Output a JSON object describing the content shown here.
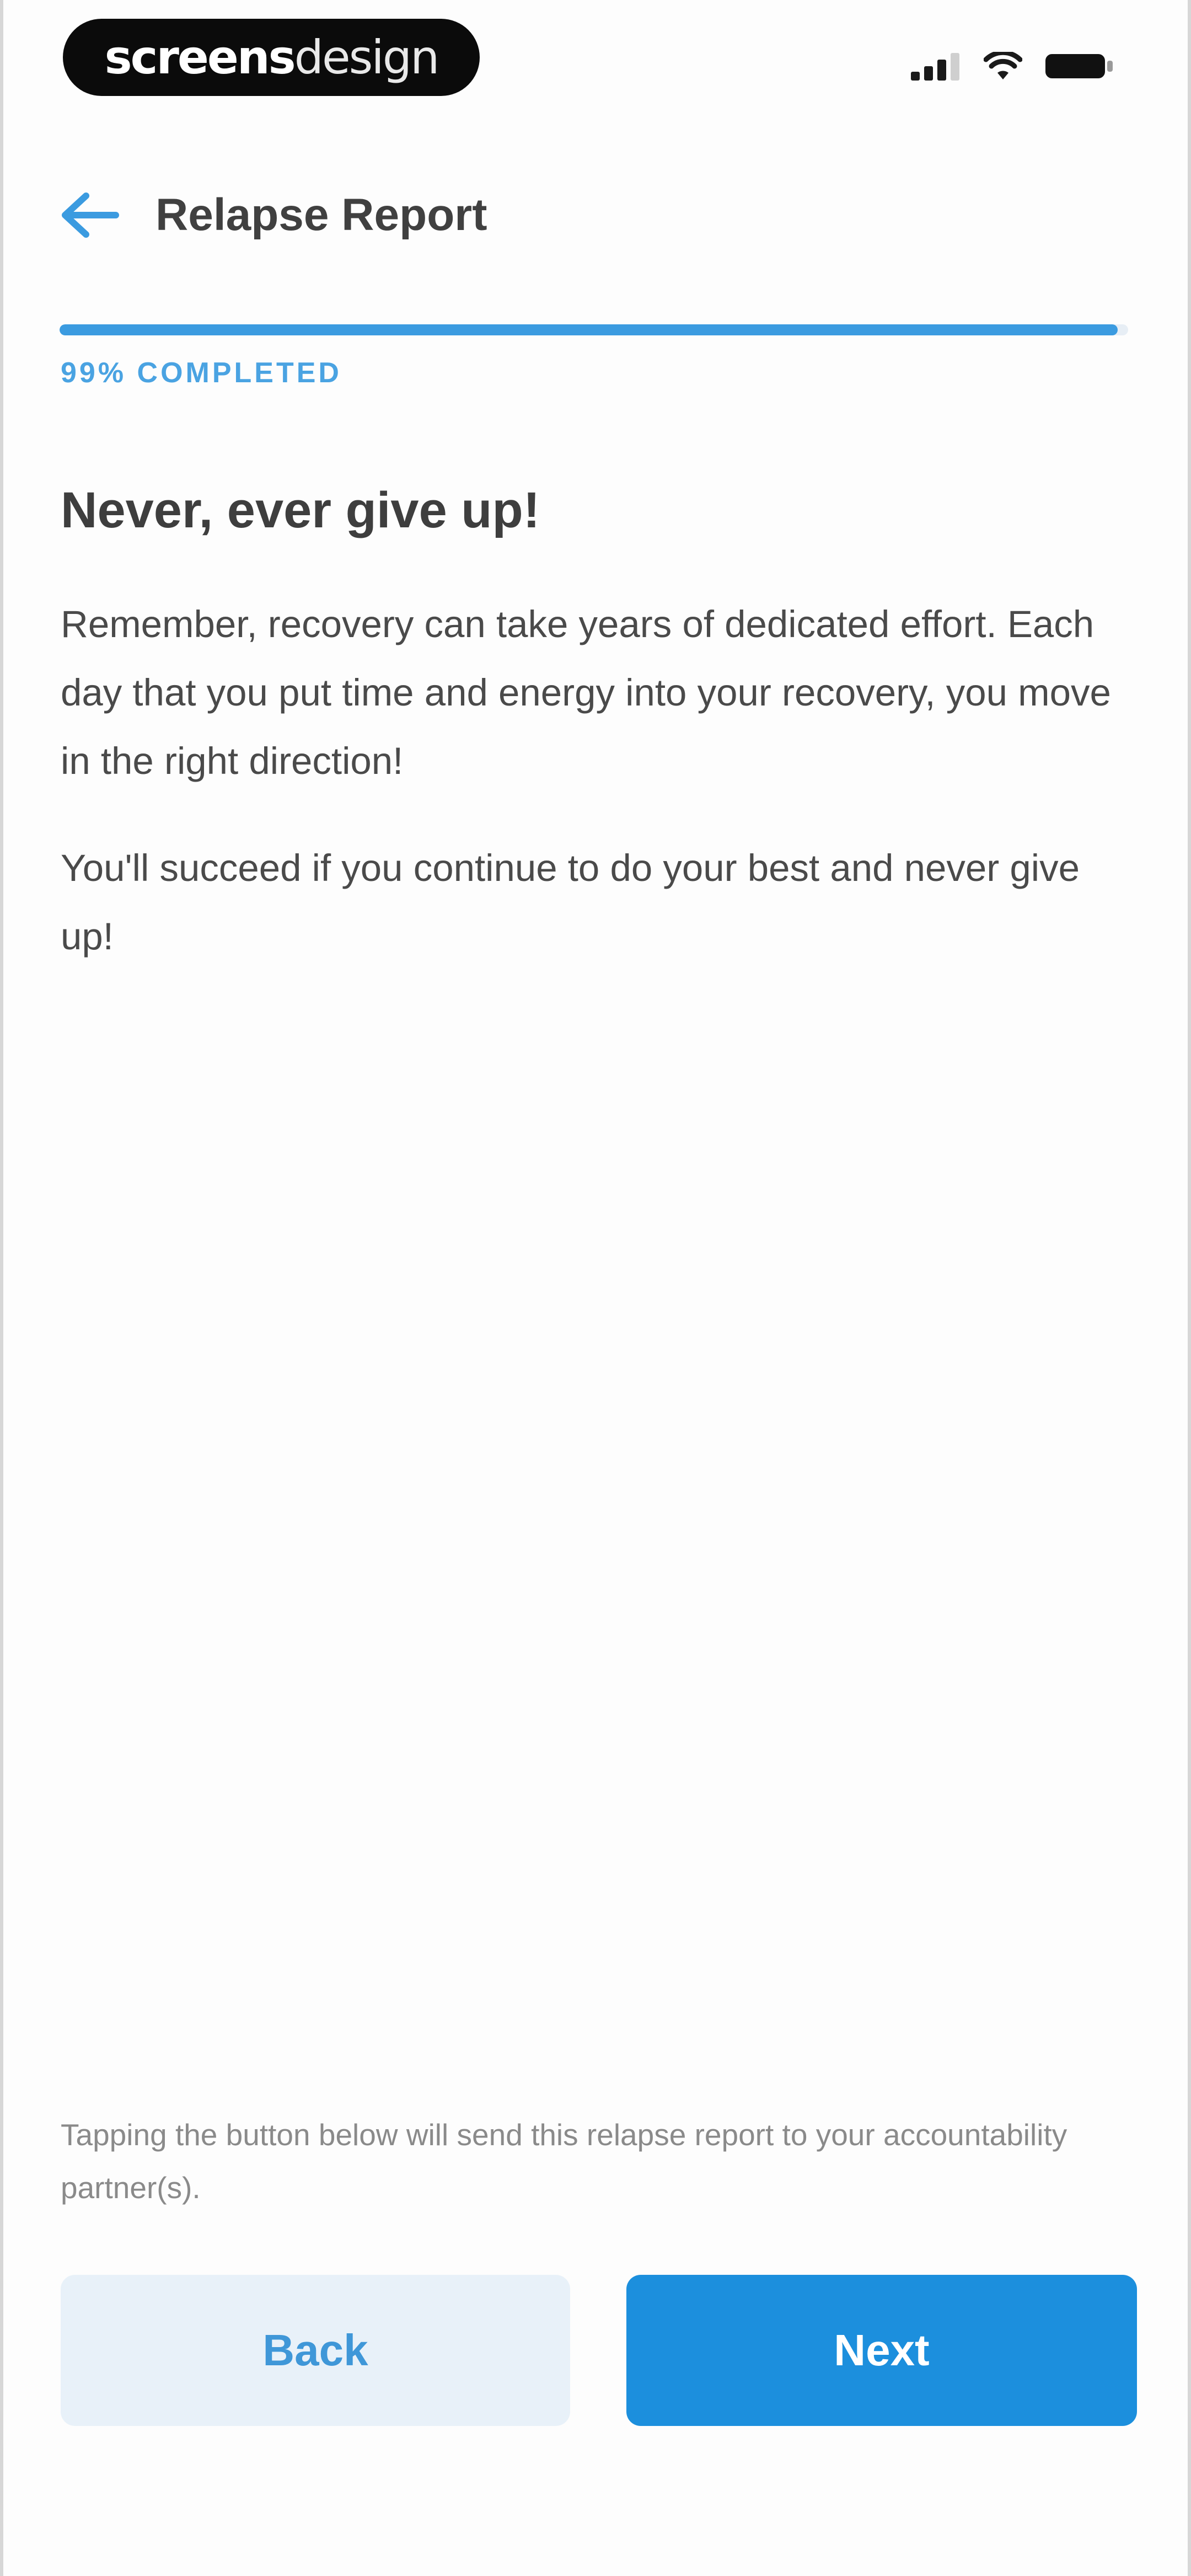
{
  "status_bar": {
    "brand_strong": "screens",
    "brand_light": "design",
    "icons": [
      "cellular-signal-icon",
      "wifi-icon",
      "battery-icon"
    ]
  },
  "header": {
    "back_icon": "arrow-left-icon",
    "title": "Relapse Report"
  },
  "progress": {
    "percent": 99,
    "label": "99% COMPLETED"
  },
  "content": {
    "headline": "Never, ever give up!",
    "paragraph_1": "Remember, recovery can take years of dedicated effort. Each day that you put time and energy into your recovery, you move in the right direction!",
    "paragraph_2": "You'll succeed if you continue to do your best and never give up!"
  },
  "footer": {
    "notice": "Tapping the button below will send this relapse report to your accountability partner(s).",
    "back_label": "Back",
    "next_label": "Next"
  },
  "colors": {
    "accent": "#1c8fdd",
    "progress": "#3b9be0",
    "back_button_bg": "#e8f1f9",
    "text_primary": "#3e3e3e"
  }
}
